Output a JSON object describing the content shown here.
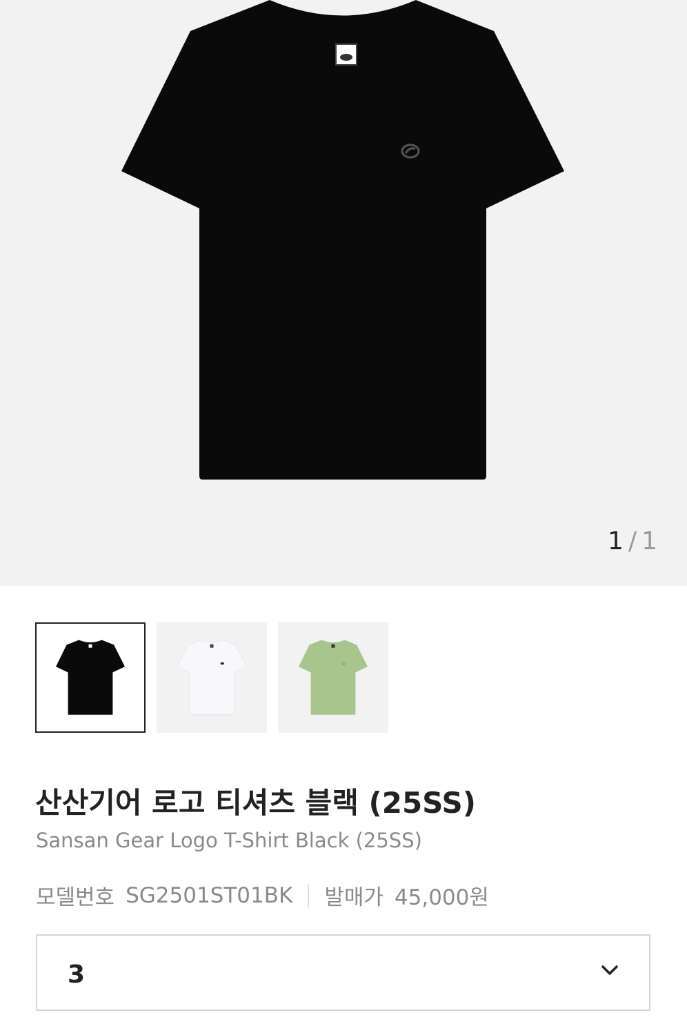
{
  "gallery": {
    "current_page": "1",
    "separator": "/",
    "total_pages": "1",
    "main_image": {
      "icon": "tshirt-icon",
      "color": "#0a0a0a",
      "label_color": "#ffffff"
    },
    "thumbnails": [
      {
        "icon": "tshirt-icon",
        "color": "#0a0a0a",
        "selected": true
      },
      {
        "icon": "tshirt-icon",
        "color": "#f8f8fb",
        "selected": false
      },
      {
        "icon": "tshirt-icon",
        "color": "#a8c48f",
        "selected": false
      }
    ]
  },
  "product": {
    "title": "산산기어 로고 티셔츠 블랙 (25SS)",
    "subtitle": "Sansan Gear Logo T-Shirt Black (25SS)",
    "model_label": "모델번호",
    "model_number": "SG2501ST01BK",
    "release_price_label": "발매가",
    "release_price": "45,000원"
  },
  "size_select": {
    "value": "3",
    "icon": "chevron-down-icon"
  }
}
